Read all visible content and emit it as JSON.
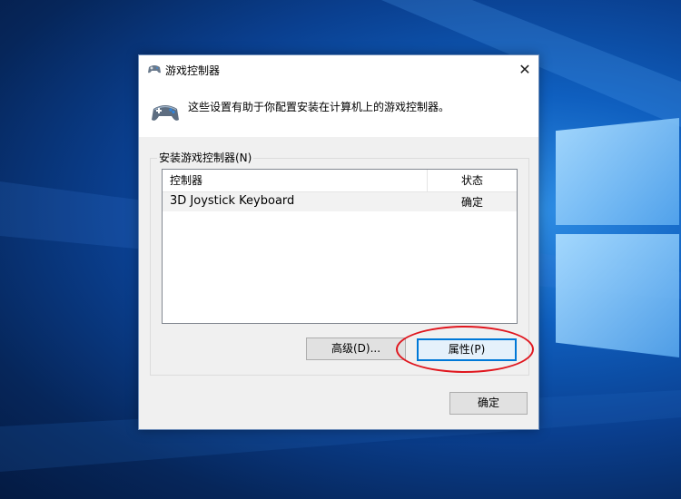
{
  "dialog": {
    "title": "游戏控制器",
    "description": "这些设置有助于你配置安装在计算机上的游戏控制器。",
    "group_label": "安装游戏控制器(N)",
    "columns": {
      "controller": "控制器",
      "status": "状态"
    },
    "rows": [
      {
        "controller": "3D Joystick Keyboard",
        "status": "确定"
      }
    ],
    "buttons": {
      "advanced": "高级(D)...",
      "properties": "属性(P)",
      "ok": "确定"
    },
    "close_icon": "close-icon"
  },
  "colors": {
    "accent": "#0078d7",
    "annotation": "#e0171f"
  }
}
